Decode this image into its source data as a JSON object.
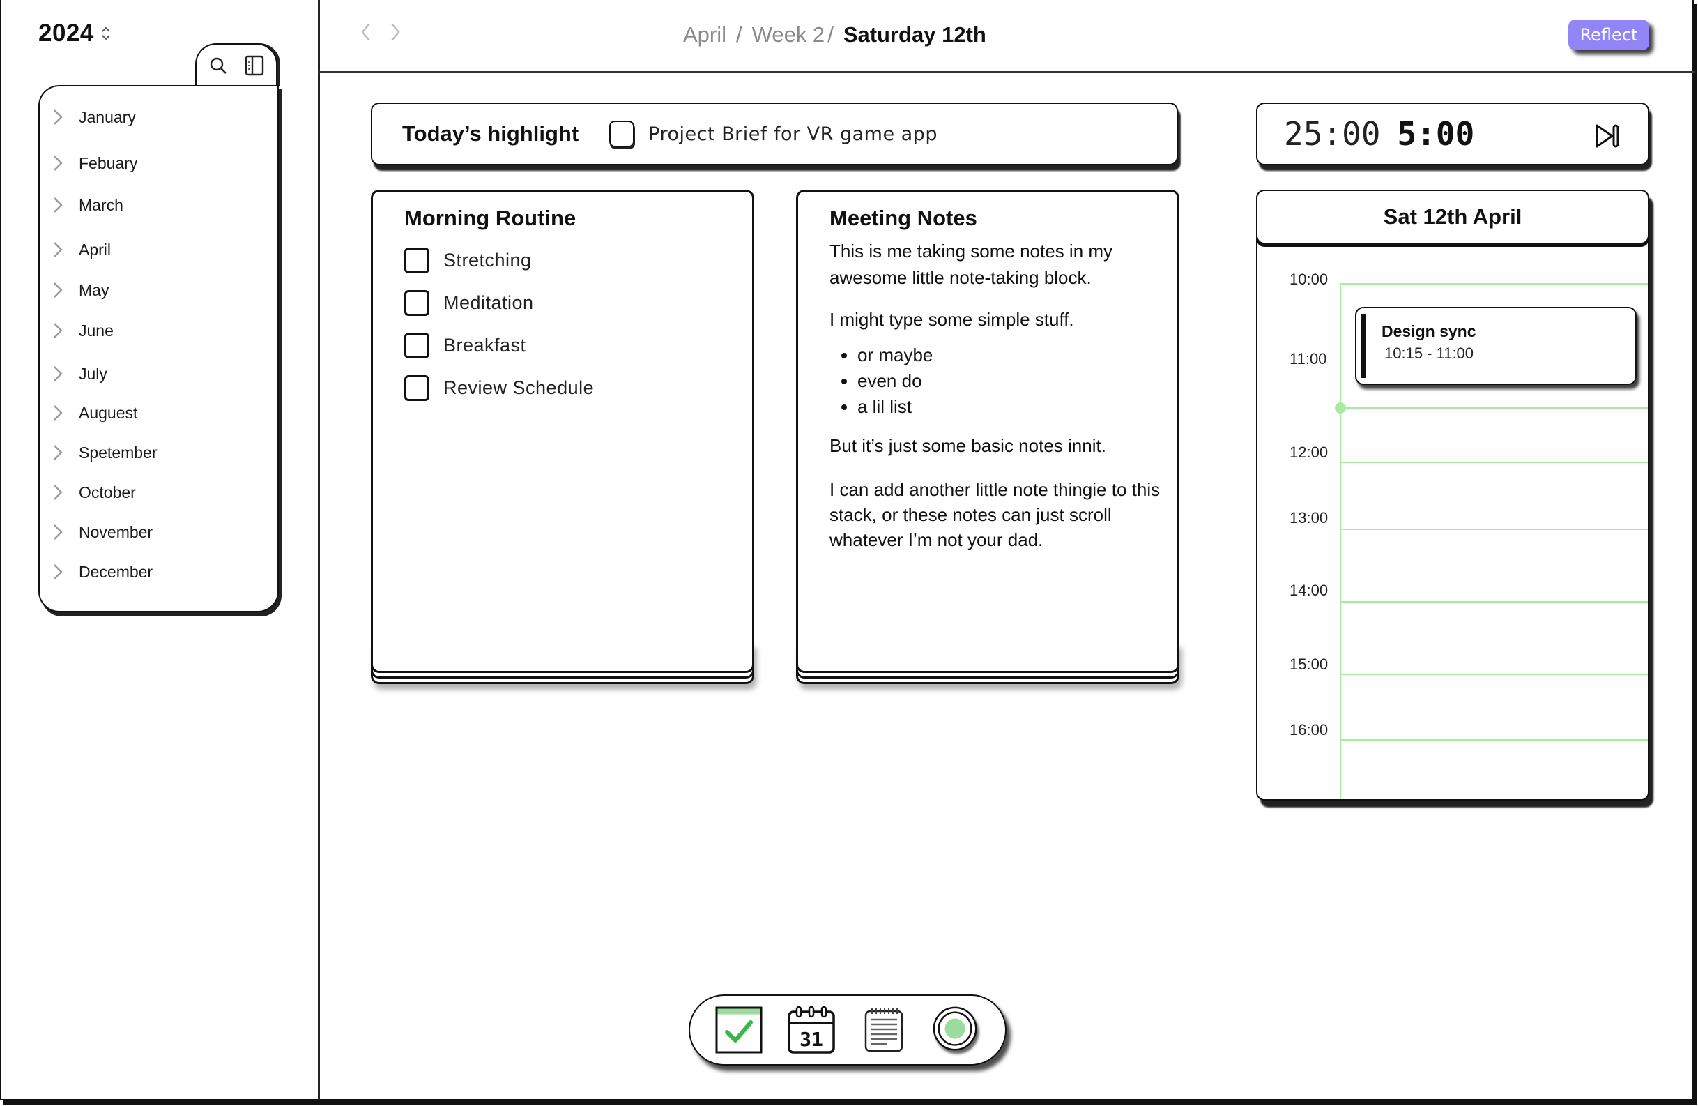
{
  "sidebar": {
    "year": "2024",
    "year_toggle_icon": "chevron-up-down-icon",
    "tools": [
      {
        "name": "search",
        "icon": "search-icon"
      },
      {
        "name": "toggle-sidebar",
        "icon": "sidebar-panel-icon"
      }
    ],
    "months": [
      {
        "label": "January"
      },
      {
        "label": "Febuary"
      },
      {
        "label": "March"
      },
      {
        "label": "April"
      },
      {
        "label": "May"
      },
      {
        "label": "June"
      },
      {
        "label": "July"
      },
      {
        "label": "Auguest"
      },
      {
        "label": "Spetember"
      },
      {
        "label": "October"
      },
      {
        "label": "November"
      },
      {
        "label": "December"
      }
    ]
  },
  "header": {
    "back_icon": "chevron-left-icon",
    "forward_icon": "chevron-right-icon",
    "breadcrumb": {
      "month": "April",
      "sep1": "/",
      "week": "Week 2",
      "sep2": "/",
      "day": "Saturday 12th"
    },
    "reflect_label": "Reflect",
    "accent": "#9185f7"
  },
  "highlight": {
    "title": "Today’s highlight",
    "task": "Project Brief for VR game app",
    "checked": false
  },
  "timer": {
    "focus": "25:00",
    "break": "5:00",
    "skip_icon": "skip-forward-icon"
  },
  "routine": {
    "title": "Morning Routine",
    "tasks": [
      {
        "label": "Stretching",
        "checked": false
      },
      {
        "label": "Meditation",
        "checked": false
      },
      {
        "label": "Breakfast",
        "checked": false
      },
      {
        "label": "Review Schedule",
        "checked": false
      }
    ]
  },
  "notes": {
    "title": "Meeting Notes",
    "p1": "This is me taking some notes in my awesome little note-taking block.",
    "p2": "I might type some simple stuff.",
    "bullets": [
      "or maybe",
      "even do",
      "a lil list"
    ],
    "p3": "But it’s just some basic notes innit.",
    "p4": "I can add another little note thingie to this stack, or these notes can just scroll whatever I’m not your dad."
  },
  "calendar": {
    "title": "Sat 12th April",
    "hours": [
      "10:00",
      "11:00",
      "12:00",
      "13:00",
      "14:00",
      "15:00",
      "16:00"
    ],
    "grid_color": "#a8eaa0",
    "current_time_marker": "11:30",
    "events": [
      {
        "title": "Design sync",
        "time": "10:15 - 11:00"
      }
    ]
  },
  "dock": {
    "items": [
      {
        "name": "tasks",
        "icon": "checkbox-check-icon",
        "active": true
      },
      {
        "name": "calendar",
        "icon": "calendar-31-icon",
        "active": false
      },
      {
        "name": "notes",
        "icon": "notepad-icon",
        "active": false
      },
      {
        "name": "record",
        "icon": "record-button-icon",
        "active": false
      }
    ],
    "check_color": "#3cb54a",
    "record_color": "#9bdc9e"
  }
}
